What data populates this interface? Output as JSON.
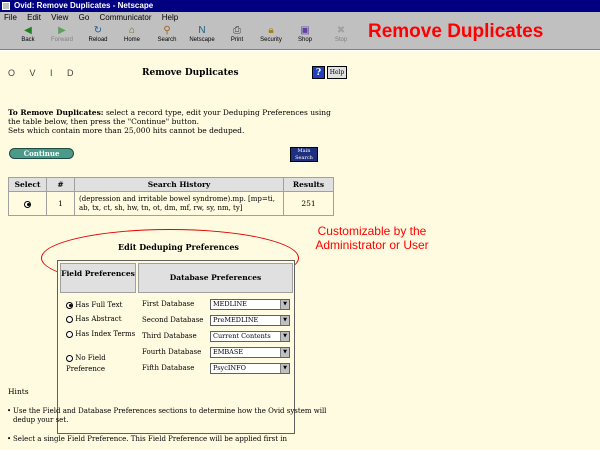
{
  "window": {
    "title": "Ovid: Remove Duplicates - Netscape",
    "menu": [
      "File",
      "Edit",
      "View",
      "Go",
      "Communicator",
      "Help"
    ]
  },
  "toolbar": {
    "buttons": [
      {
        "label": "Back",
        "icon": "back-arrow-icon"
      },
      {
        "label": "Forward",
        "icon": "forward-arrow-icon",
        "disabled": true
      },
      {
        "label": "Reload",
        "icon": "reload-icon"
      },
      {
        "label": "Home",
        "icon": "home-icon"
      },
      {
        "label": "Search",
        "icon": "search-icon"
      },
      {
        "label": "Netscape",
        "icon": "netscape-icon"
      },
      {
        "label": "Print",
        "icon": "print-icon"
      },
      {
        "label": "Security",
        "icon": "security-icon"
      },
      {
        "label": "Shop",
        "icon": "shop-icon"
      },
      {
        "label": "Stop",
        "icon": "stop-icon",
        "disabled": true
      }
    ]
  },
  "overlay_title": "Remove Duplicates",
  "page": {
    "ovid_logo": "O V I D",
    "title": "Remove Duplicates",
    "help_q": "?",
    "help_label": "Help",
    "instructions_bold": "To Remove Duplicates:",
    "instructions_1": " select a record type, edit your Deduping Preferences using the table below, then press the \"Continue\" button.",
    "instructions_2": "Sets which contain more than 25,000 hits cannot be deduped.",
    "continue_label": "Continue",
    "main_page_label": "Main Search Page"
  },
  "history": {
    "columns": [
      "Select",
      "#",
      "Search History",
      "Results"
    ],
    "rows": [
      {
        "number": "1",
        "query": "(depression and irritable bowel syndrome).mp. [mp=ti, ab, tx, ct, sh, hw, tn, ot, dm, mf, rw, sy, nm, ty]",
        "results": "251"
      }
    ]
  },
  "dedupe": {
    "title": "Edit Deduping Preferences",
    "field_pref_header": "Field Preferences",
    "db_pref_header": "Database Preferences",
    "field_options": [
      "Has Full Text",
      "Has Abstract",
      "Has Index Terms",
      "No Field Preference"
    ],
    "databases": [
      {
        "label": "First Database",
        "value": "MEDLINE"
      },
      {
        "label": "Second Database",
        "value": "PreMEDLINE"
      },
      {
        "label": "Third Database",
        "value": "Current Contents"
      },
      {
        "label": "Fourth Database",
        "value": "EMBASE"
      },
      {
        "label": "Fifth Database",
        "value": "PsycINFO"
      }
    ]
  },
  "callout": "Customizable by the Administrator or User",
  "hints": {
    "title": "Hints",
    "items": [
      "Use the Field and Database Preferences sections to determine how the Ovid system will dedup your set.",
      "Select a single Field Preference. This Field Preference will be applied first in"
    ]
  },
  "colors": {
    "title_bar": "#000080",
    "callout": "#ff0000",
    "content_bg": "#fffbe0",
    "continue": "#4a9a8a"
  }
}
